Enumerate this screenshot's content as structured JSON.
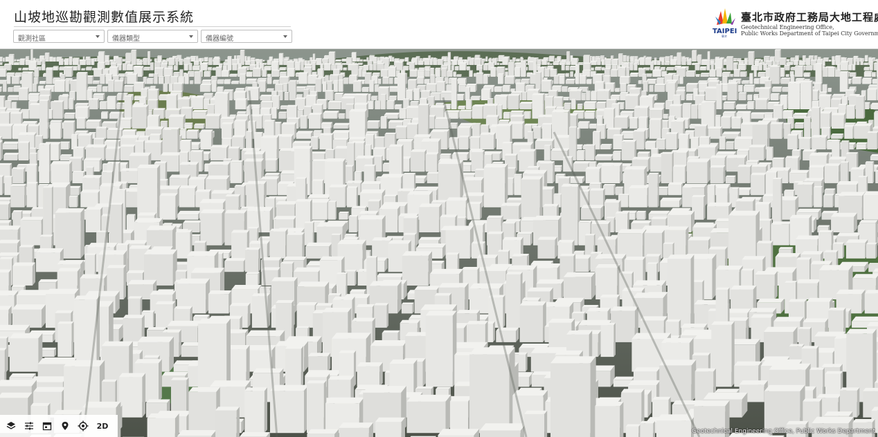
{
  "header": {
    "title": "山坡地巡勘觀測數值展示系統",
    "filters": [
      {
        "placeholder": "觀測社區"
      },
      {
        "placeholder": "儀器類型"
      },
      {
        "placeholder": "儀器編號"
      }
    ]
  },
  "logo": {
    "brand": "TAIPEI",
    "name_zh": "臺北市政府工務局大地工程處",
    "name_en_line1": "Geotechnical Engineering Office,",
    "name_en_line2": "Public Works Department of Taipei City Government"
  },
  "toolbar": {
    "items": [
      {
        "icon": "layers-icon"
      },
      {
        "icon": "sliders-icon"
      },
      {
        "icon": "calendar-icon"
      },
      {
        "icon": "location-pin-icon"
      },
      {
        "icon": "target-icon"
      },
      {
        "label": "2D"
      }
    ]
  },
  "map": {
    "attribution": "Geotechnical Engineering Office, Public Works Department"
  },
  "colors": {
    "header_bg": "#ffffff",
    "building": "#e6e6e3",
    "vegetation": "#5d7a4a",
    "sky": "#9aa7a3"
  }
}
